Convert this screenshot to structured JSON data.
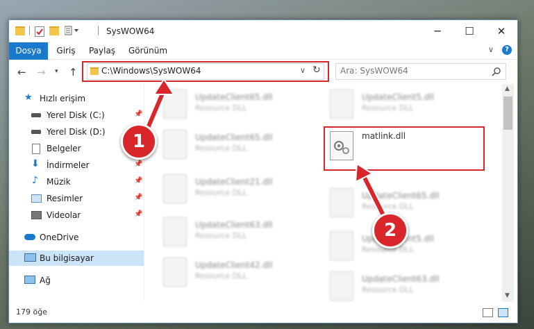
{
  "window": {
    "title": "SysWOW64"
  },
  "ribbon": {
    "tabs": [
      "Dosya",
      "Giriş",
      "Paylaş",
      "Görünüm"
    ]
  },
  "address": {
    "path": "C:\\Windows\\SysWOW64"
  },
  "search": {
    "placeholder": "Ara: SysWOW64"
  },
  "sidebar": {
    "items": [
      {
        "label": "Hızlı erişim",
        "icon": "star-icon"
      },
      {
        "label": "Yerel Disk (C:)",
        "icon": "drive-icon",
        "pinned": true
      },
      {
        "label": "Yerel Disk (D:)",
        "icon": "drive-icon",
        "pinned": true
      },
      {
        "label": "Belgeler",
        "icon": "documents-icon",
        "pinned": true
      },
      {
        "label": "İndirmeler",
        "icon": "download-icon",
        "pinned": true
      },
      {
        "label": "Müzik",
        "icon": "music-icon",
        "pinned": true
      },
      {
        "label": "Resimler",
        "icon": "pictures-icon",
        "pinned": true
      },
      {
        "label": "Videolar",
        "icon": "videos-icon",
        "pinned": true
      },
      {
        "label": "OneDrive",
        "icon": "cloud-icon"
      },
      {
        "label": "Bu bilgisayar",
        "icon": "computer-icon",
        "selected": true
      },
      {
        "label": "Ağ",
        "icon": "network-icon"
      }
    ]
  },
  "files": {
    "left": [
      {
        "name": "UpdateClient65.dll",
        "type": "Resource DLL"
      },
      {
        "name": "UpdateClient65.dll",
        "type": "Resource DLL"
      },
      {
        "name": "UpdateClient21.dll",
        "type": "Resource DLL"
      },
      {
        "name": "UpdateClient63.dll",
        "type": "Resource DLL"
      },
      {
        "name": "UpdateClient42.dll",
        "type": "Resource DLL"
      }
    ],
    "right": [
      {
        "name": "UpdateClient5.dll",
        "type": "Resource DLL"
      },
      {
        "name": "matlink.dll",
        "type": ""
      },
      {
        "name": "UpdateClient65.dll",
        "type": "Resource DLL"
      },
      {
        "name": "UpdateClient5.dll",
        "type": "Resource DLL"
      },
      {
        "name": "UpdateClient63.dll",
        "type": "Resource DLL"
      }
    ]
  },
  "status": {
    "count": "179 öğe"
  },
  "callouts": [
    "1",
    "2"
  ],
  "colors": {
    "accent": "#1979ca",
    "highlight": "#d9262b",
    "selection": "#cce4f7"
  }
}
